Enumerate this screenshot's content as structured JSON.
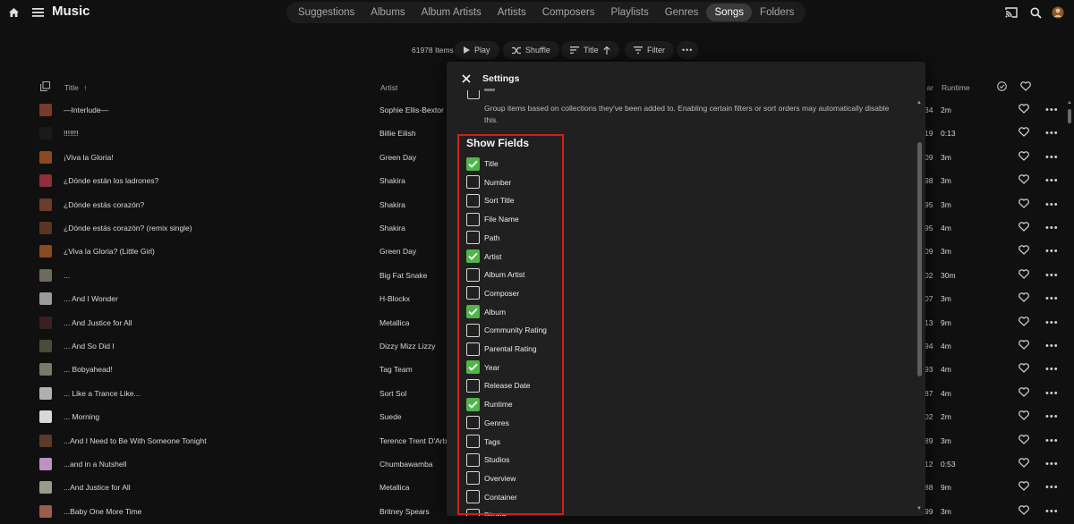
{
  "app": {
    "title": "Music"
  },
  "tabs": [
    "Suggestions",
    "Albums",
    "Album Artists",
    "Artists",
    "Composers",
    "Playlists",
    "Genres",
    "Songs",
    "Folders"
  ],
  "active_tab": "Songs",
  "toolbar": {
    "count": "61978 Items",
    "play": "Play",
    "shuffle": "Shuffle",
    "sort": "Title",
    "filter": "Filter"
  },
  "list_header": {
    "title": "Title",
    "artist": "Artist",
    "year": "Year",
    "runtime": "Runtime"
  },
  "songs": [
    {
      "title": "—Interlude—",
      "artist": "Sophie Ellis-Bextor",
      "year": "34",
      "runtime": "2m",
      "art": "#7a3a2a"
    },
    {
      "title": "!!!!!!!",
      "artist": "Billie Eilish",
      "year": "19",
      "runtime": "0:13",
      "art": "#1a1a1a"
    },
    {
      "title": "¡Viva la Gloria!",
      "artist": "Green Day",
      "year": "09",
      "runtime": "3m",
      "art": "#8a4a1e"
    },
    {
      "title": "¿Dónde están los ladrones?",
      "artist": "Shakira",
      "year": "98",
      "runtime": "3m",
      "art": "#8e2f3a"
    },
    {
      "title": "¿Dónde estás corazón?",
      "artist": "Shakira",
      "year": "95",
      "runtime": "3m",
      "art": "#6b3c2c"
    },
    {
      "title": "¿Dónde estás corazón? (remix single)",
      "artist": "Shakira",
      "year": "95",
      "runtime": "4m",
      "art": "#5c3424"
    },
    {
      "title": "¿Viva la Gloria? (Little Girl)",
      "artist": "Green Day",
      "year": "09",
      "runtime": "3m",
      "art": "#8a4a1e"
    },
    {
      "title": "...",
      "artist": "Big Fat Snake",
      "year": "02",
      "runtime": "30m",
      "art": "#6e6a5e"
    },
    {
      "title": "... And I Wonder",
      "artist": "H-Blockx",
      "year": "07",
      "runtime": "3m",
      "art": "#9a9a9a"
    },
    {
      "title": "... And Justice for All",
      "artist": "Metallica",
      "year": "13",
      "runtime": "9m",
      "art": "#3a2020"
    },
    {
      "title": "... And So Did I",
      "artist": "Dizzy Mizz Lizzy",
      "year": "94",
      "runtime": "4m",
      "art": "#4a4a3a"
    },
    {
      "title": "... Bobyahead!",
      "artist": "Tag Team",
      "year": "93",
      "runtime": "4m",
      "art": "#7a7a6a"
    },
    {
      "title": "... Like a Trance Like...",
      "artist": "Sort Sol",
      "year": "87",
      "runtime": "4m",
      "art": "#b0b0b0"
    },
    {
      "title": "... Morning",
      "artist": "Suede",
      "year": "02",
      "runtime": "2m",
      "art": "#d8d8d8"
    },
    {
      "title": "...And I Need to Be With Someone Tonight",
      "artist": "Terence Trent D'Arby",
      "year": "89",
      "runtime": "3m",
      "art": "#5a3a2a"
    },
    {
      "title": "...and in a Nutshell",
      "artist": "Chumbawamba",
      "year": "12",
      "runtime": "0:53",
      "art": "#c090c0"
    },
    {
      "title": "...And Justice for All",
      "artist": "Metallica",
      "year": "88",
      "runtime": "9m",
      "art": "#9a9a8a"
    },
    {
      "title": "...Baby One More Time",
      "artist": "Britney Spears",
      "year": "99",
      "runtime": "3m",
      "art": "#a05a4a"
    }
  ],
  "settings": {
    "title": "Settings",
    "group_description": "Group items based on collections they've been added to. Enabling certain filters or sort orders may automatically disable this.",
    "section_title": "Show Fields",
    "fields": [
      {
        "label": "Title",
        "checked": true
      },
      {
        "label": "Number",
        "checked": false
      },
      {
        "label": "Sort Title",
        "checked": false
      },
      {
        "label": "File Name",
        "checked": false
      },
      {
        "label": "Path",
        "checked": false
      },
      {
        "label": "Artist",
        "checked": true
      },
      {
        "label": "Album Artist",
        "checked": false
      },
      {
        "label": "Composer",
        "checked": false
      },
      {
        "label": "Album",
        "checked": true
      },
      {
        "label": "Community Rating",
        "checked": false
      },
      {
        "label": "Parental Rating",
        "checked": false
      },
      {
        "label": "Year",
        "checked": true
      },
      {
        "label": "Release Date",
        "checked": false
      },
      {
        "label": "Runtime",
        "checked": true
      },
      {
        "label": "Genres",
        "checked": false
      },
      {
        "label": "Tags",
        "checked": false
      },
      {
        "label": "Studios",
        "checked": false
      },
      {
        "label": "Overview",
        "checked": false
      },
      {
        "label": "Container",
        "checked": false
      },
      {
        "label": "Bitrate",
        "checked": false
      }
    ]
  },
  "colors": {
    "accent": "#52b54b",
    "highlight": "#d21d1d",
    "background": "#101010",
    "dialog": "#202020"
  }
}
